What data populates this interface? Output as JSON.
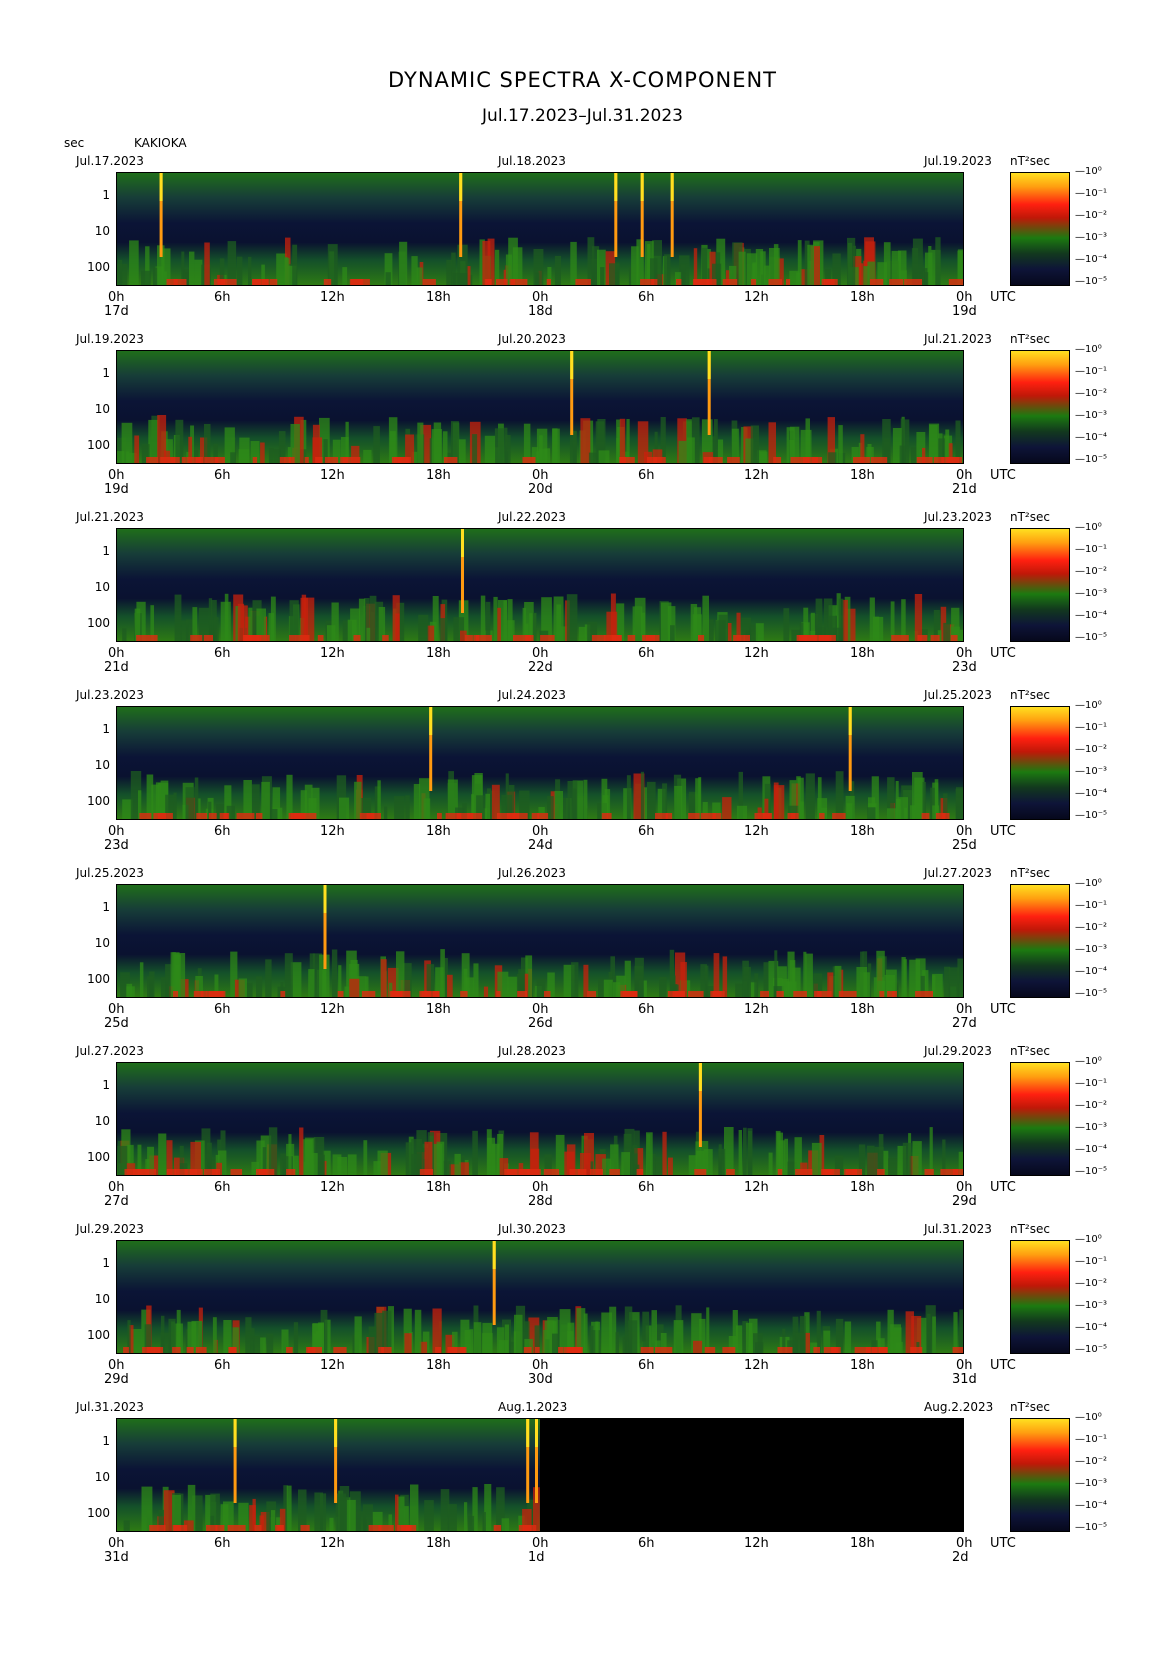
{
  "title": "DYNAMIC SPECTRA X-COMPONENT",
  "subtitle": "Jul.17.2023–Jul.31.2023",
  "y_unit": "sec",
  "station": "KAKIOKA",
  "colorbar_unit": "nT²sec",
  "x_tick_labels": [
    "0h",
    "6h",
    "12h",
    "18h",
    "0h",
    "6h",
    "12h",
    "18h",
    "0h"
  ],
  "utc_label": "UTC",
  "y_tick_labels": [
    "1",
    "10",
    "100"
  ],
  "colorbar_ticks": [
    "10⁰",
    "10⁻¹",
    "10⁻²",
    "10⁻³",
    "10⁻⁴",
    "10⁻⁵"
  ],
  "colors": {
    "low": "#06081c",
    "mid": "#1c7a10",
    "high": "#ff2010",
    "peak": "#ffe020"
  },
  "chart_data": {
    "type": "heatmap",
    "title": "DYNAMIC SPECTRA X-COMPONENT",
    "subtitle": "Jul.17.2023–Jul.31.2023",
    "ylabel": "sec",
    "y_scale": "log",
    "colorbar_scale": "log",
    "clim": [
      1e-05,
      1
    ],
    "panels": [
      {
        "date_left": "Jul.17.2023",
        "date_mid": "Jul.18.2023",
        "date_right": "Jul.19.2023",
        "day_labels": [
          "17d",
          "18d",
          "19d"
        ],
        "spikes_hours": [
          2.5,
          19.5,
          28.3,
          29.8,
          31.5
        ]
      },
      {
        "date_left": "Jul.19.2023",
        "date_mid": "Jul.20.2023",
        "date_right": "Jul.21.2023",
        "day_labels": [
          "19d",
          "20d",
          "21d"
        ],
        "spikes_hours": [
          25.8,
          33.6
        ]
      },
      {
        "date_left": "Jul.21.2023",
        "date_mid": "Jul.22.2023",
        "date_right": "Jul.23.2023",
        "day_labels": [
          "21d",
          "22d",
          "23d"
        ],
        "spikes_hours": [
          19.6
        ]
      },
      {
        "date_left": "Jul.23.2023",
        "date_mid": "Jul.24.2023",
        "date_right": "Jul.25.2023",
        "day_labels": [
          "23d",
          "24d",
          "25d"
        ],
        "spikes_hours": [
          17.8,
          41.6
        ]
      },
      {
        "date_left": "Jul.25.2023",
        "date_mid": "Jul.26.2023",
        "date_right": "Jul.27.2023",
        "day_labels": [
          "25d",
          "26d",
          "27d"
        ],
        "spikes_hours": [
          11.8
        ]
      },
      {
        "date_left": "Jul.27.2023",
        "date_mid": "Jul.28.2023",
        "date_right": "Jul.29.2023",
        "day_labels": [
          "27d",
          "28d",
          "29d"
        ],
        "spikes_hours": [
          33.1
        ]
      },
      {
        "date_left": "Jul.29.2023",
        "date_mid": "Jul.30.2023",
        "date_right": "Jul.31.2023",
        "day_labels": [
          "29d",
          "30d",
          "31d"
        ],
        "spikes_hours": [
          21.4
        ]
      },
      {
        "date_left": "Jul.31.2023",
        "date_mid": "Aug.1.2023",
        "date_right": "Aug.2.2023",
        "day_labels": [
          "31d",
          "1d",
          "2d"
        ],
        "spikes_hours": [
          6.7,
          12.4,
          23.3,
          23.8
        ],
        "data_end_hour": 24
      }
    ]
  }
}
